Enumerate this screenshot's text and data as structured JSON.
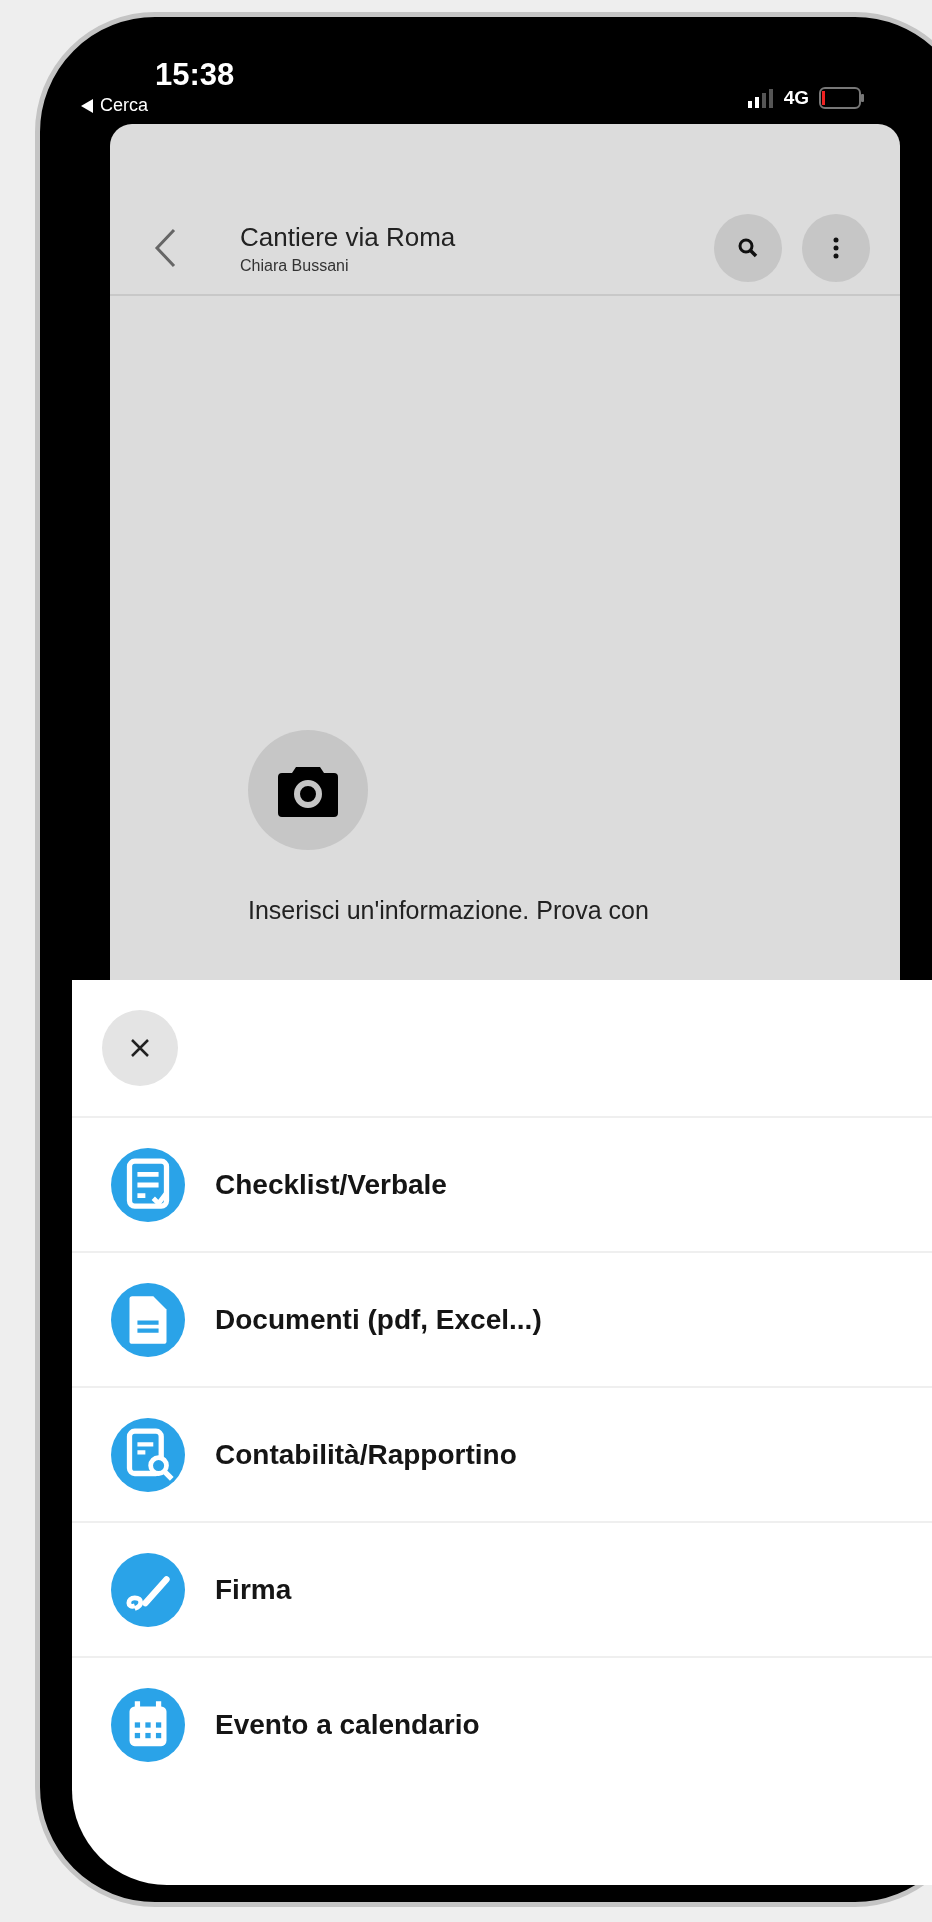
{
  "status_bar": {
    "time": "15:38",
    "back_label": "Cerca",
    "network": "4G"
  },
  "header": {
    "title": "Cantiere via Roma",
    "subtitle": "Chiara Bussani"
  },
  "empty_state": {
    "text": "Inserisci un'informazione. Prova con"
  },
  "sheet": {
    "items": [
      {
        "kind": "checklist",
        "label": "Checklist/Verbale"
      },
      {
        "kind": "document",
        "label": "Documenti (pdf, Excel...)"
      },
      {
        "kind": "report",
        "label": "Contabilità/Rapportino"
      },
      {
        "kind": "signature",
        "label": "Firma"
      },
      {
        "kind": "calendar",
        "label": "Evento a calendario"
      }
    ]
  }
}
